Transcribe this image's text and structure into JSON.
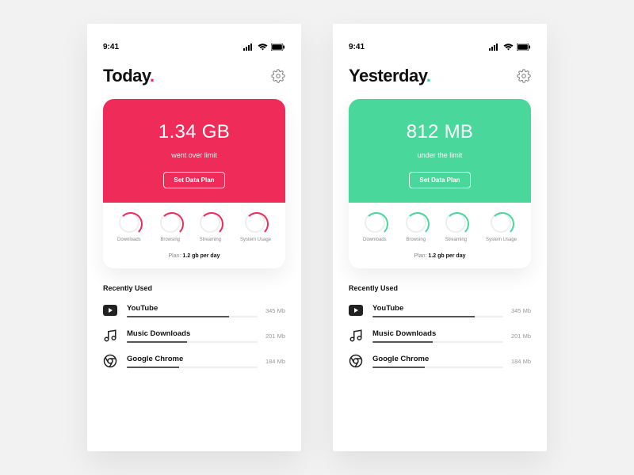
{
  "statusbar": {
    "time": "9:41"
  },
  "screens": [
    {
      "title": "Today",
      "accent": "pink",
      "usage": {
        "amount": "1.34 GB",
        "status": "went over limit",
        "button": "Set Data Plan"
      },
      "categories": [
        {
          "label": "Downloads"
        },
        {
          "label": "Browsing"
        },
        {
          "label": "Streaming"
        },
        {
          "label": "System Usage"
        }
      ],
      "plan": {
        "prefix": "Plan:",
        "value": "1.2 gb per day"
      },
      "recent_label": "Recently Used",
      "apps": [
        {
          "name": "YouTube",
          "size": "345 Mb",
          "pct": 78,
          "icon": "youtube"
        },
        {
          "name": "Music Downloads",
          "size": "201 Mb",
          "pct": 46,
          "icon": "music"
        },
        {
          "name": "Google Chrome",
          "size": "184 Mb",
          "pct": 40,
          "icon": "chrome"
        }
      ]
    },
    {
      "title": "Yesterday",
      "accent": "green",
      "usage": {
        "amount": "812 MB",
        "status": "under the limit",
        "button": "Set Data Plan"
      },
      "categories": [
        {
          "label": "Downloads"
        },
        {
          "label": "Browsing"
        },
        {
          "label": "Streaming"
        },
        {
          "label": "System Usage"
        }
      ],
      "plan": {
        "prefix": "Plan:",
        "value": "1.2 gb per day"
      },
      "recent_label": "Recently Used",
      "apps": [
        {
          "name": "YouTube",
          "size": "345 Mb",
          "pct": 78,
          "icon": "youtube"
        },
        {
          "name": "Music Downloads",
          "size": "201 Mb",
          "pct": 46,
          "icon": "music"
        },
        {
          "name": "Google Chrome",
          "size": "184 Mb",
          "pct": 40,
          "icon": "chrome"
        }
      ]
    }
  ]
}
